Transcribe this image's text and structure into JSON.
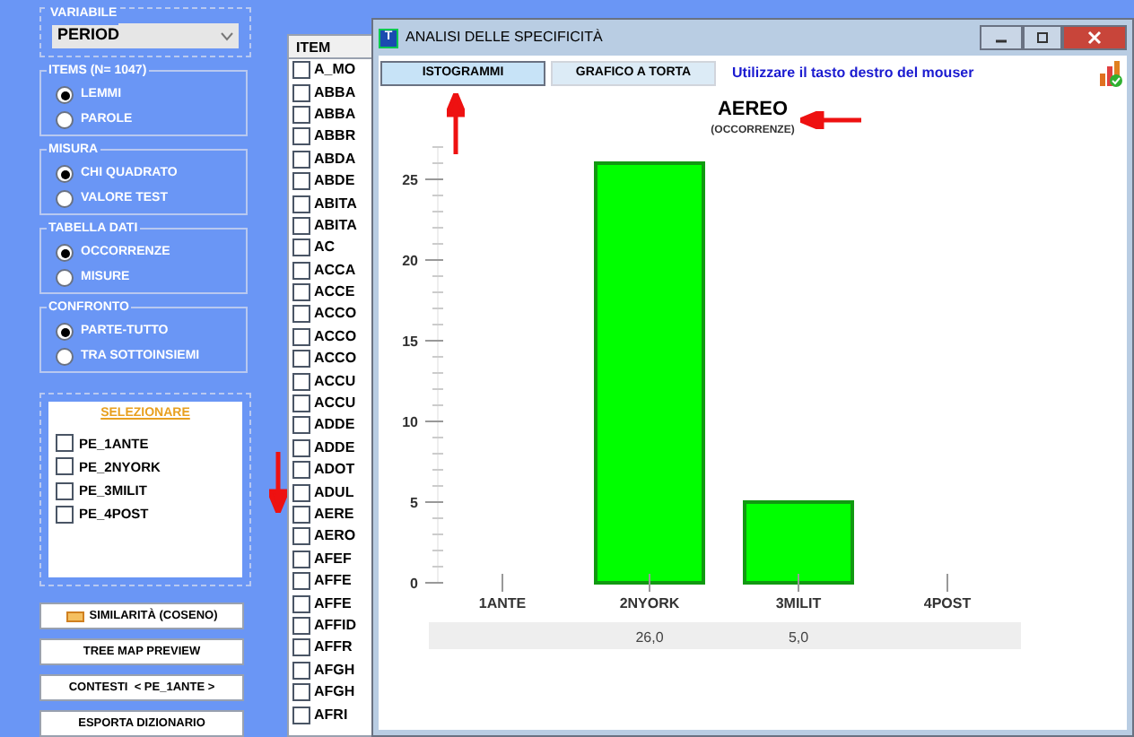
{
  "variabile": {
    "label": "VARIABILE",
    "value": "PERIOD"
  },
  "groups": [
    {
      "label": "ITEMS (N= 1047)",
      "options": [
        {
          "label": "LEMMI",
          "selected": true
        },
        {
          "label": "PAROLE",
          "selected": false
        }
      ]
    },
    {
      "label": "MISURA",
      "options": [
        {
          "label": "CHI QUADRATO",
          "selected": true
        },
        {
          "label": "VALORE TEST",
          "selected": false
        }
      ]
    },
    {
      "label": "TABELLA DATI",
      "options": [
        {
          "label": "OCCORRENZE",
          "selected": true
        },
        {
          "label": "MISURE",
          "selected": false
        }
      ]
    },
    {
      "label": "CONFRONTO",
      "options": [
        {
          "label": "PARTE-TUTTO",
          "selected": true
        },
        {
          "label": "TRA SOTTOINSIEMI",
          "selected": false
        }
      ]
    }
  ],
  "selezionare": {
    "title": "SELEZIONARE",
    "items": [
      {
        "label": "PE_1ANTE",
        "checked": false
      },
      {
        "label": "PE_2NYORK",
        "checked": false
      },
      {
        "label": "PE_3MILIT",
        "checked": false
      },
      {
        "label": "PE_4POST",
        "checked": false
      }
    ]
  },
  "buttons": [
    {
      "label": "SIMILARITÀ (COSENO)",
      "kind": "icon"
    },
    {
      "label": "TREE MAP PREVIEW",
      "kind": "plain"
    },
    {
      "label": "CONTESTI  < PE_1ANTE >",
      "kind": "plain"
    },
    {
      "label": "ESPORTA DIZIONARIO",
      "kind": "plain"
    }
  ],
  "item_list": {
    "header": "ITEM",
    "items": [
      {
        "label": "A_MO",
        "checked": false
      },
      {
        "label": "ABBA",
        "checked": false
      },
      {
        "label": "ABBA",
        "checked": false
      },
      {
        "label": "ABBR",
        "checked": false
      },
      {
        "label": "ABDA",
        "checked": false
      },
      {
        "label": "ABDE",
        "checked": false
      },
      {
        "label": "ABITA",
        "checked": false
      },
      {
        "label": "ABITA",
        "checked": false
      },
      {
        "label": "AC",
        "checked": false
      },
      {
        "label": "ACCA",
        "checked": false
      },
      {
        "label": "ACCE",
        "checked": false
      },
      {
        "label": "ACCO",
        "checked": false
      },
      {
        "label": "ACCO",
        "checked": false
      },
      {
        "label": "ACCO",
        "checked": false
      },
      {
        "label": "ACCU",
        "checked": false
      },
      {
        "label": "ACCU",
        "checked": false
      },
      {
        "label": "ADDE",
        "checked": false
      },
      {
        "label": "ADDE",
        "checked": false
      },
      {
        "label": "ADOT",
        "checked": false
      },
      {
        "label": "ADUL",
        "checked": false
      },
      {
        "label": "AERE",
        "checked": false
      },
      {
        "label": "AERO",
        "checked": false
      },
      {
        "label": "AFEF",
        "checked": false
      },
      {
        "label": "AFFE",
        "checked": false
      },
      {
        "label": "AFFE",
        "checked": false
      },
      {
        "label": "AFFID",
        "checked": false
      },
      {
        "label": "AFFR",
        "checked": false
      },
      {
        "label": "AFGH",
        "checked": false
      },
      {
        "label": "AFGH",
        "checked": false
      },
      {
        "label": "AFRI",
        "checked": false
      }
    ]
  },
  "window": {
    "icon_letter": "T",
    "title": "ANALISI DELLE SPECIFICITÀ",
    "tabs": [
      {
        "label": "ISTOGRAMMI",
        "selected": true
      },
      {
        "label": "GRAFICO A TORTA",
        "selected": false
      }
    ],
    "hint": "Utilizzare il tasto destro del mouser",
    "chart_subtitle": "(OCCORRENZE)",
    "chart_data": {
      "type": "bar",
      "title": "AEREO",
      "categories": [
        "1ANTE",
        "2NYORK",
        "3MILIT",
        "4POST"
      ],
      "series": [
        {
          "color": "#00ff00",
          "values": [
            0,
            26,
            5,
            0
          ]
        }
      ],
      "ylim": [
        0,
        27
      ],
      "yticks": [
        0,
        5,
        10,
        15,
        20,
        25
      ],
      "value_labels": [
        null,
        "26,0",
        "5,0",
        null
      ]
    }
  }
}
